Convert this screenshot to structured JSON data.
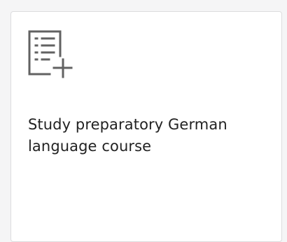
{
  "card": {
    "icon": "add-to-list-icon",
    "title": "Study preparatory German language course"
  },
  "colors": {
    "icon_stroke": "#626262",
    "text": "#222222",
    "card_border": "#dcdcde",
    "background": "#f5f5f6"
  }
}
